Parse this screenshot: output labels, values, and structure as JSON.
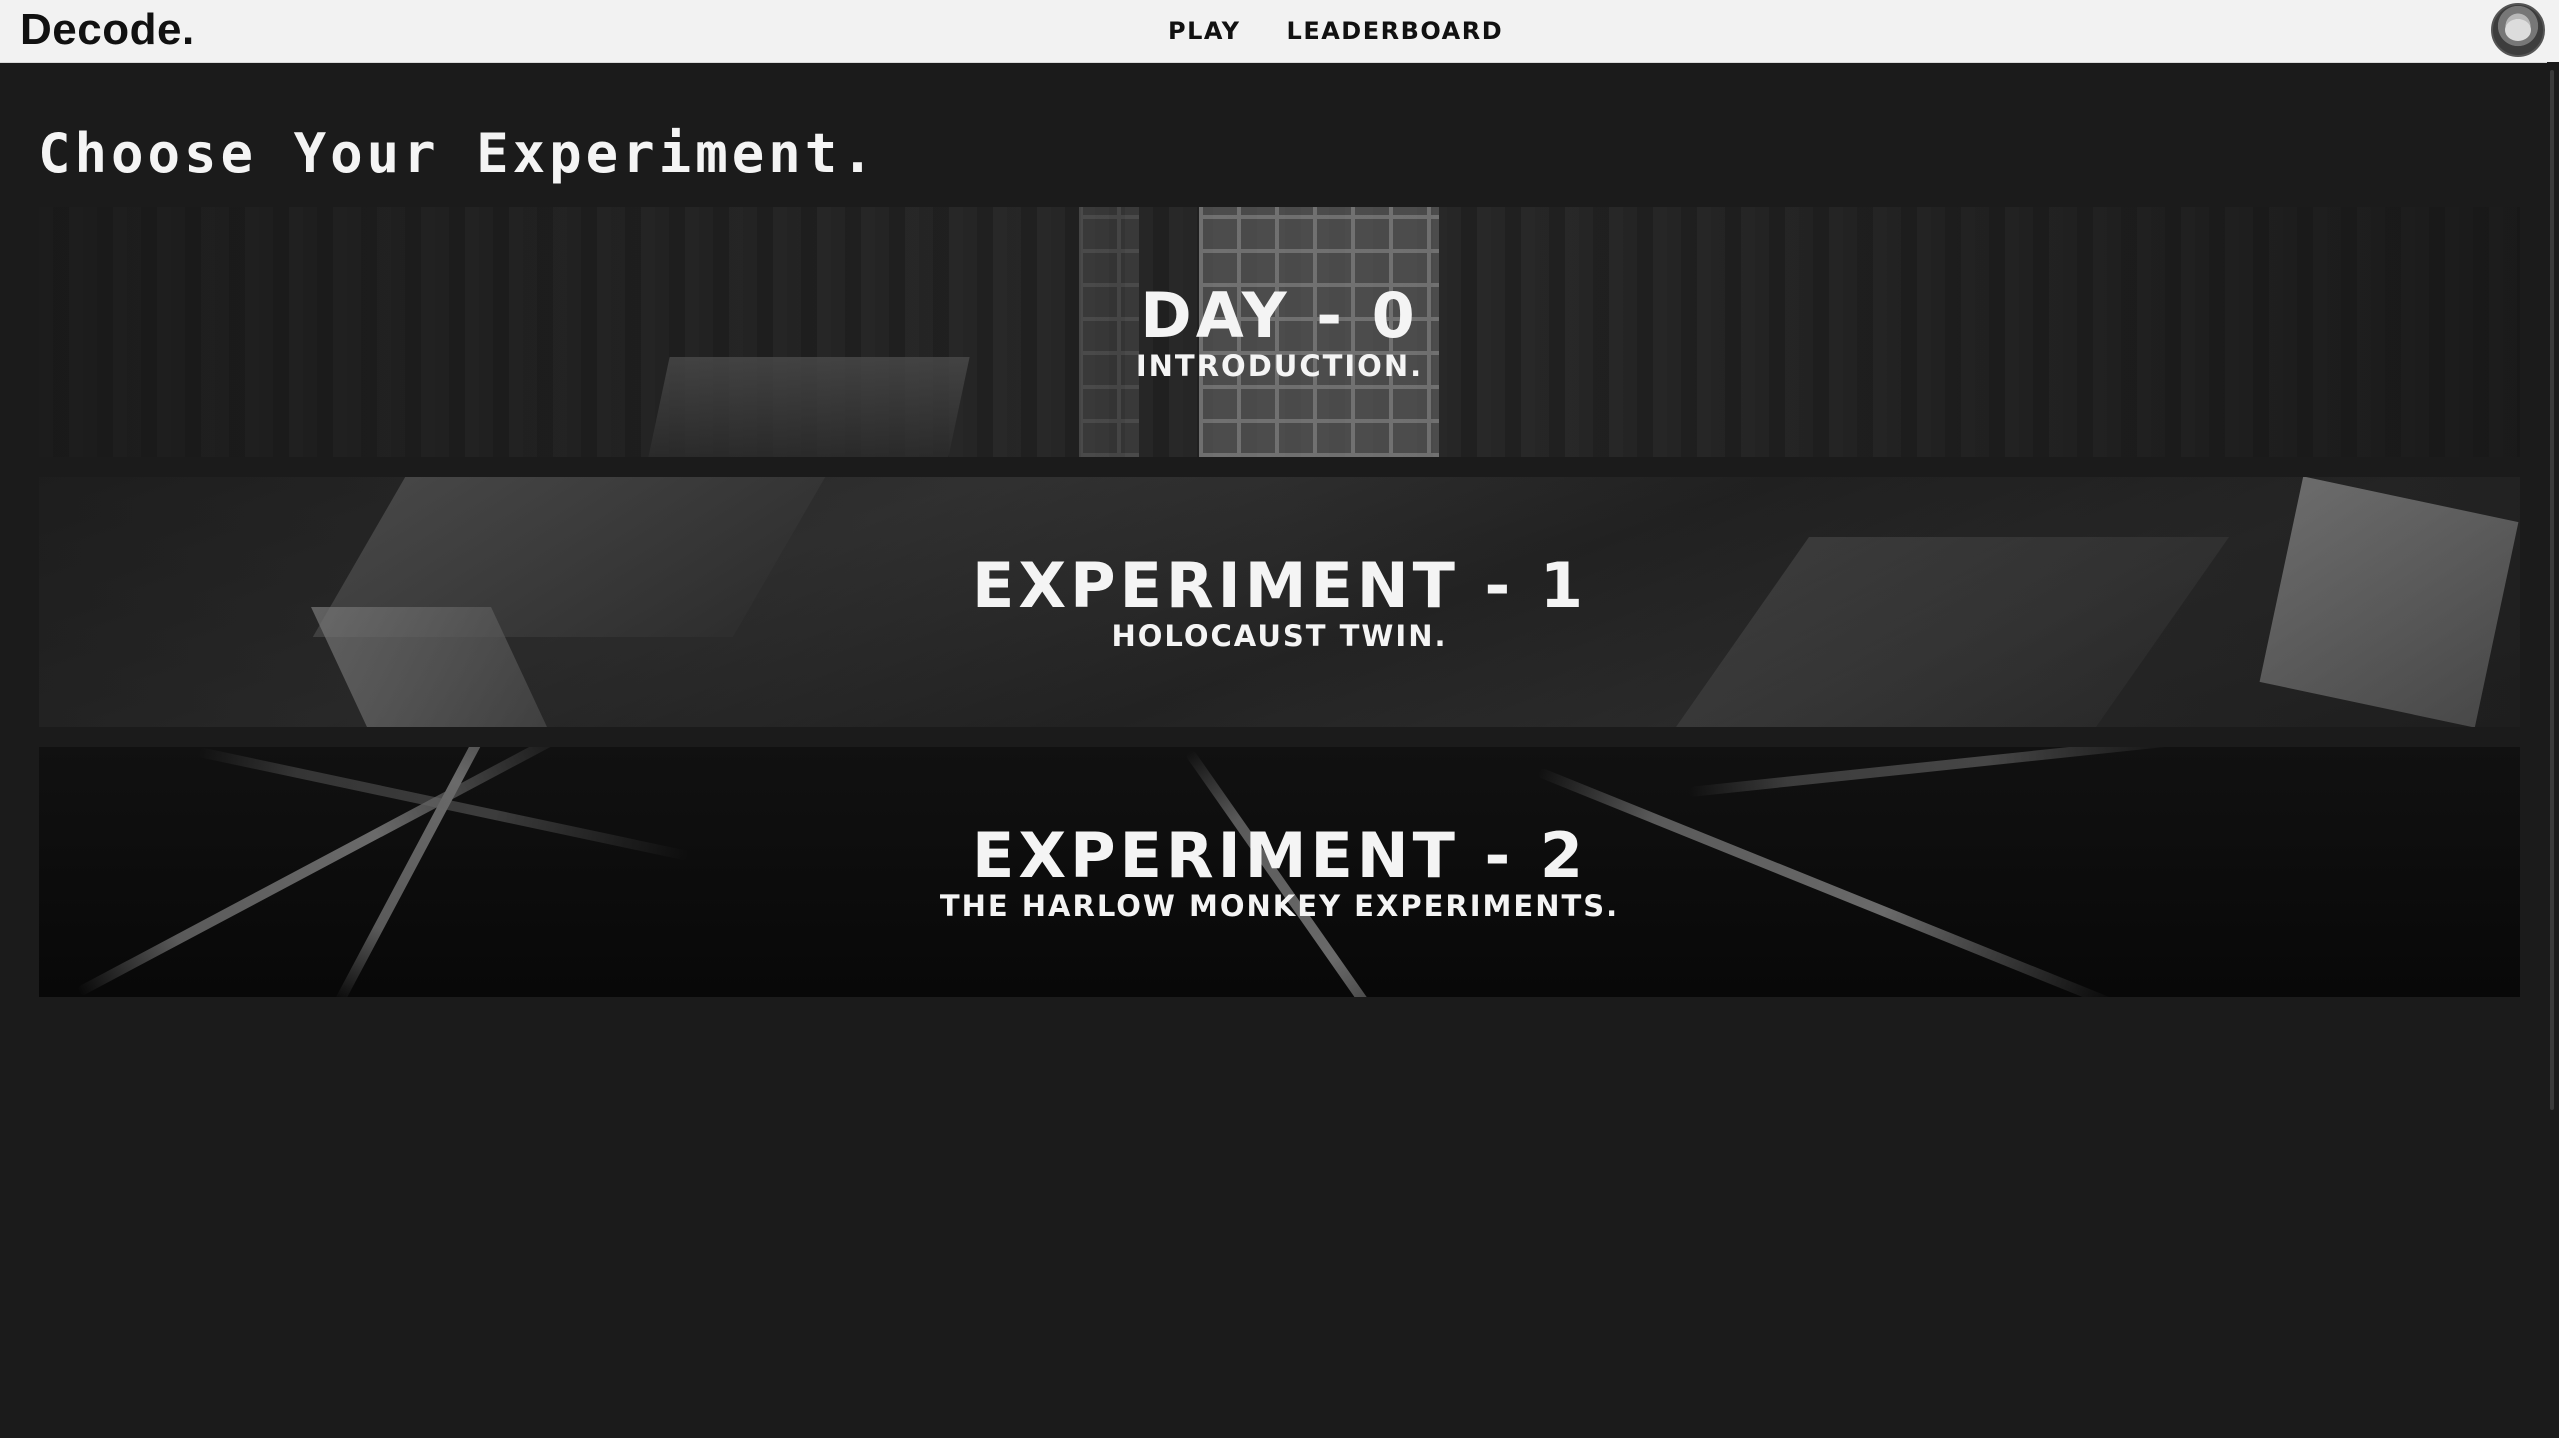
{
  "header": {
    "logo": "Decode.",
    "nav": [
      {
        "label": "PLAY"
      },
      {
        "label": "LEADERBOARD"
      }
    ]
  },
  "main": {
    "title": "Choose Your Experiment.",
    "experiments": [
      {
        "title": "DAY - 0",
        "subtitle": "INTRODUCTION."
      },
      {
        "title": "EXPERIMENT - 1",
        "subtitle": "HOLOCAUST TWIN."
      },
      {
        "title": "EXPERIMENT - 2",
        "subtitle": "THE HARLOW MONKEY EXPERIMENTS."
      }
    ]
  },
  "colors": {
    "background": "#1b1b1b",
    "header": "#f2f2f2",
    "text_light": "#f4f4f4",
    "text_dark": "#111111"
  }
}
